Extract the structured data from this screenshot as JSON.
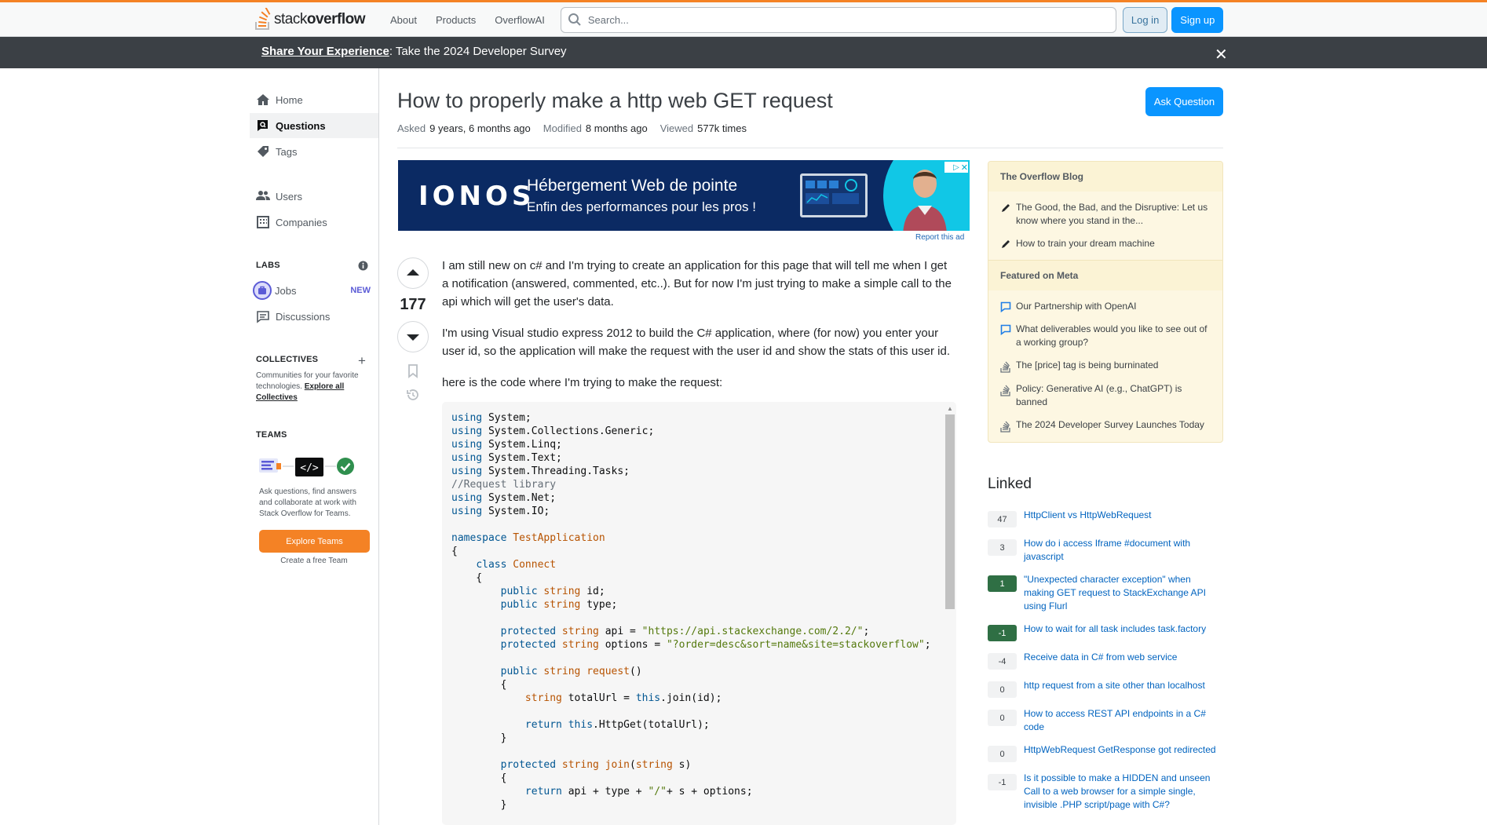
{
  "header": {
    "logo_text_light": "stack",
    "logo_text_bold": "overflow",
    "nav": [
      "About",
      "Products",
      "OverflowAI"
    ],
    "search_placeholder": "Search...",
    "login": "Log in",
    "signup": "Sign up"
  },
  "notice": {
    "strong": "Share Your Experience",
    "rest": ": Take the 2024 Developer Survey",
    "close": "✕"
  },
  "sidebar": {
    "home": "Home",
    "questions": "Questions",
    "tags": "Tags",
    "users": "Users",
    "companies": "Companies",
    "labs_heading": "LABS",
    "jobs": "Jobs",
    "jobs_badge": "NEW",
    "discussions": "Discussions",
    "collectives_heading": "COLLECTIVES",
    "collectives_text": "Communities for your favorite technologies.",
    "collectives_link": "Explore all Collectives",
    "teams_heading": "TEAMS",
    "teams_text": "Ask questions, find answers and collaborate at work with Stack Overflow for Teams.",
    "explore_teams": "Explore Teams",
    "create_team": "Create a free Team"
  },
  "question": {
    "title": "How to properly make a http web GET request",
    "ask_button": "Ask Question",
    "asked_label": "Asked",
    "asked_value": "9 years, 6 months ago",
    "modified_label": "Modified",
    "modified_value": "8 months ago",
    "viewed_label": "Viewed",
    "viewed_value": "577k times",
    "votes": "177",
    "body": [
      "I am still new on c# and I'm trying to create an application for this page that will tell me when I get a notification (answered, commented, etc..). But for now I'm just trying to make a simple call to the api which will get the user's data.",
      "I'm using Visual studio express 2012 to build the C# application, where (for now) you enter your user id, so the application will make the request with the user id and show the stats of this user id.",
      "here is the code where I'm trying to make the request:"
    ]
  },
  "ad": {
    "brand": "IONOS",
    "line1": "Hébergement Web de pointe",
    "line2": "Enfin des performances pour les pros !",
    "report": "Report this ad"
  },
  "blog": {
    "heading": "The Overflow Blog",
    "items": [
      "The Good, the Bad, and the Disruptive: Let us know where you stand in the...",
      "How to train your dream machine"
    ]
  },
  "meta_featured": {
    "heading": "Featured on Meta",
    "items": [
      "Our Partnership with OpenAI",
      "What deliverables would you like to see out of a working group?",
      "The [price] tag is being burninated",
      "Policy: Generative AI (e.g., ChatGPT) is banned",
      "The 2024 Developer Survey Launches Today"
    ]
  },
  "linked": {
    "heading": "Linked",
    "items": [
      {
        "score": "47",
        "title": "HttpClient vs HttpWebRequest",
        "accepted": false
      },
      {
        "score": "3",
        "title": "How do i access Iframe #document with javascript",
        "accepted": false
      },
      {
        "score": "1",
        "title": "\"Unexpected character exception\" when making GET request to StackExchange API using Flurl",
        "accepted": true
      },
      {
        "score": "-1",
        "title": "How to wait for all task includes task.factory",
        "accepted": true
      },
      {
        "score": "-4",
        "title": "Receive data in C# from web service",
        "accepted": false
      },
      {
        "score": "0",
        "title": "http request from a site other than localhost",
        "accepted": false
      },
      {
        "score": "0",
        "title": "How to access REST API endpoints in a C# code",
        "accepted": false
      },
      {
        "score": "0",
        "title": "HttpWebRequest GetResponse got redirected",
        "accepted": false
      },
      {
        "score": "-1",
        "title": "Is it possible to make a HIDDEN and unseen Call to a web browser for a simple single, invisible .PHP script/page with C#?",
        "accepted": false
      }
    ]
  },
  "code_lines": [
    [
      [
        "kw",
        "using"
      ],
      [
        "",
        "System;"
      ]
    ],
    [
      [
        "kw",
        "using"
      ],
      [
        "",
        "System.Collections.Generic;"
      ]
    ],
    [
      [
        "kw",
        "using"
      ],
      [
        "",
        "System.Linq;"
      ]
    ],
    [
      [
        "kw",
        "using"
      ],
      [
        "",
        "System.Text;"
      ]
    ],
    [
      [
        "kw",
        "using"
      ],
      [
        "",
        "System.Threading.Tasks;"
      ]
    ],
    [
      [
        "cm",
        "//Request library"
      ]
    ],
    [
      [
        "kw",
        "using"
      ],
      [
        "",
        "System.Net;"
      ]
    ],
    [
      [
        "kw",
        "using"
      ],
      [
        "",
        "System.IO;"
      ]
    ],
    [],
    [
      [
        "kw",
        "namespace"
      ],
      [
        "ty",
        "TestApplication"
      ]
    ],
    [
      [
        "",
        "{"
      ]
    ],
    [
      [
        "",
        "    "
      ],
      [
        "kw",
        "class"
      ],
      [
        "ty",
        "Connect"
      ]
    ],
    [
      [
        "",
        "    {"
      ]
    ],
    [
      [
        "",
        "        "
      ],
      [
        "kw",
        "public"
      ],
      [
        "ty",
        "string"
      ],
      [
        "",
        "id;"
      ]
    ],
    [
      [
        "",
        "        "
      ],
      [
        "kw",
        "public"
      ],
      [
        "ty",
        "string"
      ],
      [
        "",
        "type;"
      ]
    ],
    [],
    [
      [
        "",
        "        "
      ],
      [
        "kw",
        "protected"
      ],
      [
        "ty",
        "string"
      ],
      [
        "",
        "api = "
      ],
      [
        "st",
        "\"https://api.stackexchange.com/2.2/\""
      ],
      [
        "",
        ";"
      ]
    ],
    [
      [
        "",
        "        "
      ],
      [
        "kw",
        "protected"
      ],
      [
        "ty",
        "string"
      ],
      [
        "",
        "options = "
      ],
      [
        "st",
        "\"?order=desc&sort=name&site=stackoverflow\""
      ],
      [
        "",
        ";"
      ]
    ],
    [],
    [
      [
        "",
        "        "
      ],
      [
        "kw",
        "public"
      ],
      [
        "ty",
        "string"
      ],
      [
        "fn",
        "request"
      ],
      [
        "",
        "()"
      ]
    ],
    [
      [
        "",
        "        {"
      ]
    ],
    [
      [
        "",
        "            "
      ],
      [
        "ty",
        "string"
      ],
      [
        "",
        "totalUrl = "
      ],
      [
        "kw",
        "this"
      ],
      [
        "",
        ".join(id);"
      ]
    ],
    [],
    [
      [
        "",
        "            "
      ],
      [
        "kw",
        "return"
      ],
      [
        "kw",
        "this"
      ],
      [
        "",
        ".HttpGet(totalUrl);"
      ]
    ],
    [
      [
        "",
        "        }"
      ]
    ],
    [],
    [
      [
        "",
        "        "
      ],
      [
        "kw",
        "protected"
      ],
      [
        "ty",
        "string"
      ],
      [
        "fn",
        "join"
      ],
      [
        "",
        "("
      ],
      [
        "ty",
        "string"
      ],
      [
        "",
        "s)"
      ]
    ],
    [
      [
        "",
        "        {"
      ]
    ],
    [
      [
        "",
        "            "
      ],
      [
        "kw",
        "return"
      ],
      [
        "",
        "api + type + "
      ],
      [
        "st",
        "\"/\""
      ],
      [
        "",
        ""
      ],
      [
        "",
        "+ s + options;"
      ]
    ],
    [
      [
        "",
        "        }"
      ]
    ]
  ]
}
